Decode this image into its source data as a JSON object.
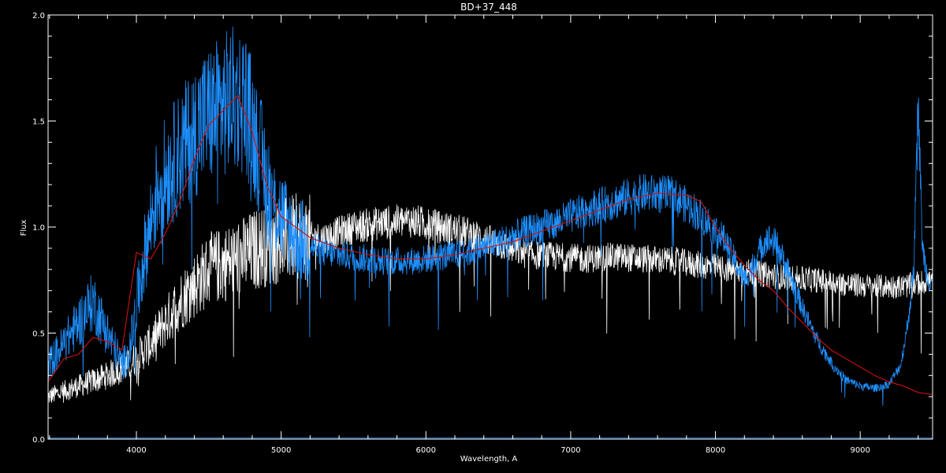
{
  "chart_data": {
    "type": "line",
    "title": "BD+37_448",
    "xlabel": "Wavelength, A",
    "ylabel": "Flux",
    "xlim": [
      3390,
      9500
    ],
    "ylim": [
      0.0,
      2.0
    ],
    "grid": false,
    "background": "#000000",
    "x_ticks": [
      4000,
      5000,
      6000,
      7000,
      8000,
      9000
    ],
    "x_tick_labels": [
      "4000",
      "5000",
      "6000",
      "7000",
      "8000",
      "9000"
    ],
    "y_ticks": [
      0.0,
      0.5,
      1.0,
      1.5,
      2.0
    ],
    "y_tick_labels": [
      "0.0",
      "0.5",
      "1.0",
      "1.5",
      "2.0"
    ],
    "series": [
      {
        "color": "#ffffff",
        "style": "noisy",
        "x": [
          3390,
          3600,
          3800,
          3950,
          4100,
          4300,
          4500,
          4700,
          4900,
          5100,
          5300,
          5500,
          5700,
          5900,
          6100,
          6300,
          6500,
          6700,
          6900,
          7100,
          7300,
          7500,
          7700,
          7900,
          8100,
          8300,
          8500,
          8700,
          8900,
          9100,
          9300,
          9500
        ],
        "y": [
          0.2,
          0.25,
          0.3,
          0.35,
          0.45,
          0.65,
          0.8,
          0.85,
          0.92,
          0.95,
          0.95,
          1.0,
          1.02,
          1.03,
          1.0,
          0.97,
          0.92,
          0.87,
          0.86,
          0.85,
          0.86,
          0.85,
          0.84,
          0.82,
          0.8,
          0.78,
          0.76,
          0.75,
          0.73,
          0.72,
          0.72,
          0.75
        ]
      },
      {
        "color": "#1e90ff",
        "style": "noisy",
        "x": [
          3390,
          3500,
          3600,
          3700,
          3800,
          3900,
          3950,
          4050,
          4150,
          4250,
          4350,
          4450,
          4550,
          4650,
          4750,
          4850,
          4950,
          5100,
          5300,
          5500,
          5700,
          5900,
          6100,
          6300,
          6500,
          6700,
          6900,
          7100,
          7300,
          7500,
          7700,
          7850,
          7950,
          8050,
          8150,
          8200,
          8280,
          8350,
          8420,
          8500,
          8600,
          8700,
          8800,
          8900,
          9000,
          9100,
          9200,
          9280,
          9330,
          9370,
          9400,
          9430,
          9470,
          9500
        ],
        "y": [
          0.35,
          0.45,
          0.55,
          0.65,
          0.5,
          0.35,
          0.4,
          0.85,
          1.2,
          1.3,
          1.4,
          1.5,
          1.55,
          1.6,
          1.6,
          1.35,
          1.1,
          0.95,
          0.88,
          0.86,
          0.84,
          0.84,
          0.86,
          0.88,
          0.93,
          0.98,
          1.02,
          1.08,
          1.12,
          1.16,
          1.15,
          1.08,
          1.02,
          0.95,
          0.82,
          0.75,
          0.85,
          0.95,
          0.92,
          0.8,
          0.62,
          0.47,
          0.36,
          0.28,
          0.25,
          0.24,
          0.26,
          0.35,
          0.55,
          0.8,
          1.6,
          0.9,
          0.75,
          0.75
        ]
      },
      {
        "color": "#d01010",
        "style": "smooth",
        "x": [
          3390,
          3500,
          3600,
          3700,
          3800,
          3900,
          4000,
          4100,
          4200,
          4300,
          4400,
          4500,
          4600,
          4700,
          4800,
          4900,
          5000,
          5200,
          5400,
          5600,
          5800,
          6000,
          6200,
          6400,
          6600,
          6800,
          7000,
          7200,
          7400,
          7600,
          7800,
          7900,
          8000,
          8100,
          8200,
          8300,
          8400,
          8500,
          8600,
          8700,
          8800,
          8900,
          9000,
          9100,
          9200,
          9300,
          9400,
          9500
        ],
        "y": [
          0.27,
          0.38,
          0.4,
          0.48,
          0.46,
          0.42,
          0.88,
          0.85,
          0.97,
          1.12,
          1.32,
          1.48,
          1.55,
          1.62,
          1.45,
          1.2,
          1.05,
          0.95,
          0.9,
          0.87,
          0.85,
          0.85,
          0.87,
          0.9,
          0.93,
          0.98,
          1.03,
          1.08,
          1.13,
          1.16,
          1.15,
          1.12,
          1.0,
          0.9,
          0.82,
          0.75,
          0.7,
          0.62,
          0.55,
          0.48,
          0.42,
          0.38,
          0.34,
          0.3,
          0.27,
          0.25,
          0.22,
          0.21
        ]
      },
      {
        "color": "#1e90ff",
        "style": "baseline",
        "x": [
          3390,
          9500
        ],
        "y": [
          0.005,
          0.005
        ]
      }
    ]
  }
}
